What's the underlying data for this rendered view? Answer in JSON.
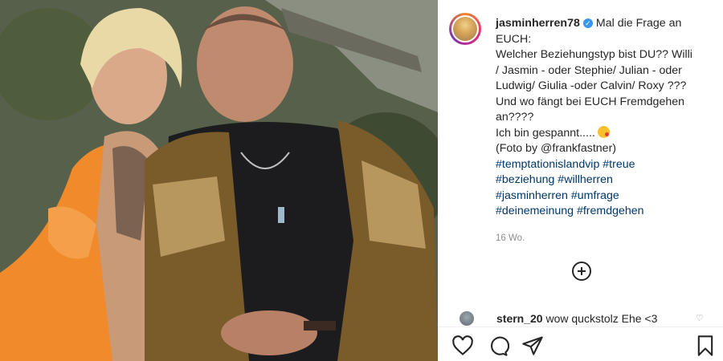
{
  "post": {
    "username": "jasminherren78",
    "caption_lines": [
      "Mal die Frage an",
      "EUCH:",
      "Welcher Beziehungstyp bist DU?? Willi",
      "/ Jasmin - oder Stephie/ Julian - oder",
      "Ludwig/ Giulia -oder Calvin/ Roxy ???",
      "Und wo fängt bei EUCH Fremdgehen",
      "an????",
      "Ich bin gespannt.....",
      "(Foto by @frankfastner)"
    ],
    "hashtag_lines": [
      "#temptationislandvip #treue",
      "#beziehung #willherren",
      "#jasminherren #umfrage",
      "#deinemeinung #fremdgehen"
    ],
    "time_ago": "16 Wo."
  },
  "comment": {
    "username": "stern_20",
    "text": "wow quckstolz Ehe <3"
  },
  "icons": {
    "verified": "verified-badge-icon",
    "emoji": "kiss-face-emoji",
    "add": "add-circle-icon",
    "like": "heart-icon",
    "comment": "comment-icon",
    "share": "paper-plane-icon",
    "save": "bookmark-icon",
    "comment_like": "small-heart-icon"
  },
  "colors": {
    "text": "#262626",
    "hashtag": "#00376b",
    "muted": "#8e8e8e",
    "verified": "#3897f0"
  }
}
